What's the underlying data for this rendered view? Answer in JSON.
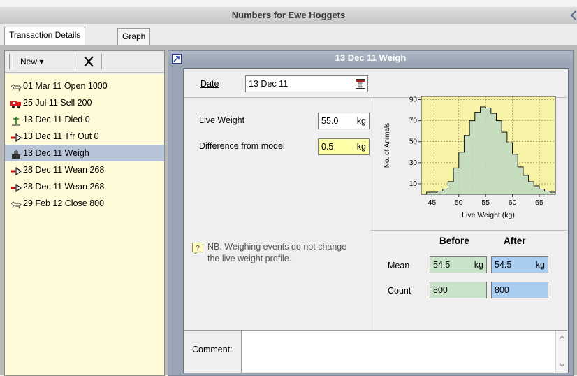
{
  "window": {
    "title": "Numbers for Ewe Hoggets"
  },
  "tabs": [
    {
      "label": "Transaction Details",
      "active": true
    },
    {
      "label": "Graph",
      "active": false
    }
  ],
  "toolbar": {
    "new_label": "New ▾"
  },
  "events": [
    {
      "label": "01 Mar 11 Open 1000",
      "icon": "sheep-icon",
      "selected": false
    },
    {
      "label": "25 Jul 11 Sell 200",
      "icon": "truck-icon",
      "selected": false
    },
    {
      "label": "13 Dec 11 Died 0",
      "icon": "grave-cross-icon",
      "selected": false
    },
    {
      "label": "13 Dec 11 Tfr Out 0",
      "icon": "transfer-arrow-icon",
      "selected": false
    },
    {
      "label": "13 Dec 11 Weigh",
      "icon": "scale-icon",
      "selected": true
    },
    {
      "label": "28 Dec 11 Wean 268",
      "icon": "transfer-arrow-icon",
      "selected": false
    },
    {
      "label": "28 Dec 11 Wean 268",
      "icon": "transfer-arrow-icon",
      "selected": false
    },
    {
      "label": "29 Feb 12 Close 800",
      "icon": "sheep-icon",
      "selected": false
    }
  ],
  "detail": {
    "header": "13 Dec 11  Weigh",
    "date_label": "Date",
    "date_value": "13 Dec 11",
    "live_weight_label": "Live Weight",
    "live_weight_value": "55.0",
    "live_weight_unit": "kg",
    "diff_label": "Difference from model",
    "diff_value": "0.5",
    "diff_unit": "kg",
    "note": "NB. Weighing events do not change the live weight profile.",
    "comment_label": "Comment:",
    "comment_value": ""
  },
  "stats": {
    "before_label": "Before",
    "after_label": "After",
    "mean_label": "Mean",
    "count_label": "Count",
    "mean_before": "54.5",
    "mean_after": "54.5",
    "mean_unit": "kg",
    "count_before": "800",
    "count_after": "800"
  },
  "colors": {
    "list_bg": "#fffbd9",
    "selected_row": "#b7c3d7",
    "before_field": "#c9e3c9",
    "after_field": "#a9cdf0",
    "chart_bg": "#f7f3a6",
    "histogram_fill": "#c6dcbf"
  },
  "chart_data": {
    "type": "histogram",
    "xlabel": "Live Weight (kg)",
    "ylabel": "No. of Animals",
    "xlim": [
      43,
      68
    ],
    "ylim": [
      0,
      93
    ],
    "xticks": [
      45,
      50,
      55,
      60,
      65
    ],
    "yticks": [
      10,
      30,
      50,
      70,
      90
    ],
    "bin_edges": [
      43,
      44,
      45,
      46,
      47,
      48,
      49,
      50,
      51,
      52,
      53,
      54,
      55,
      56,
      57,
      58,
      59,
      60,
      61,
      62,
      63,
      64,
      65,
      66,
      67,
      68
    ],
    "counts": [
      0,
      2,
      2,
      3,
      5,
      12,
      25,
      40,
      56,
      70,
      78,
      83,
      82,
      77,
      70,
      59,
      49,
      38,
      26,
      18,
      12,
      8,
      5,
      3,
      2
    ],
    "grid": true
  }
}
